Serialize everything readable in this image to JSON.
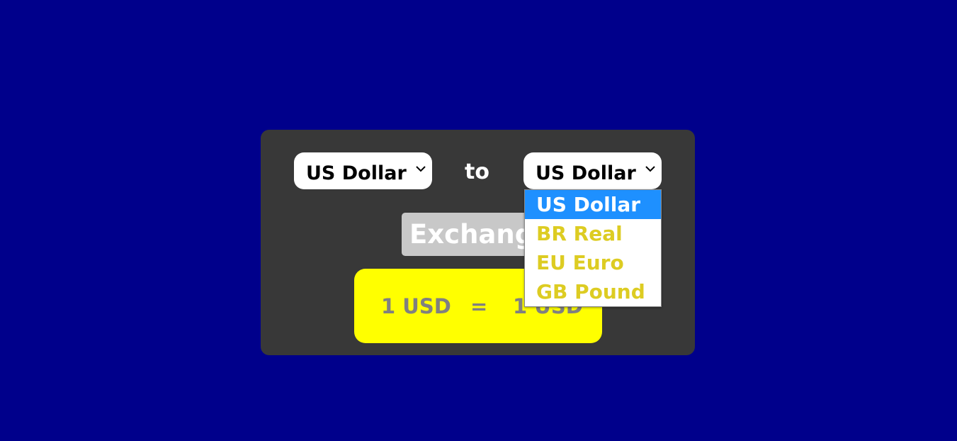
{
  "converter": {
    "from_select": {
      "value": "US Dollar"
    },
    "to_label": "to",
    "to_select": {
      "value": "US Dollar"
    },
    "exchange_button_label": "Exchange",
    "result": {
      "left": "1 USD",
      "equals": "=",
      "right": "1 USD"
    }
  },
  "dropdown": {
    "options": [
      "US Dollar",
      "BR Real",
      "EU Euro",
      "GB Pound"
    ],
    "selected": "US Dollar"
  },
  "colors": {
    "background": "#00008b",
    "card": "#383838",
    "result_box": "#ffff00",
    "selected_option": "#1e90ff",
    "option_text": "#ddcc22"
  },
  "icons": {
    "select_arrow": "chevron-down-icon"
  }
}
